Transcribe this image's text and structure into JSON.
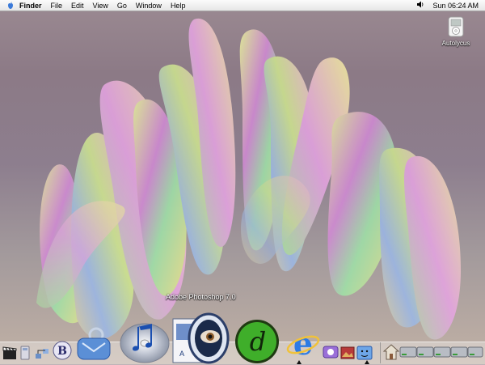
{
  "menubar": {
    "app_name": "Finder",
    "menus": [
      "File",
      "Edit",
      "View",
      "Go",
      "Window",
      "Help"
    ],
    "clock": "Sun 06:24 AM"
  },
  "desktop": {
    "disk_label": "Autolycus"
  },
  "dock": {
    "tooltip": "Adobe Photoshop 7.0"
  }
}
